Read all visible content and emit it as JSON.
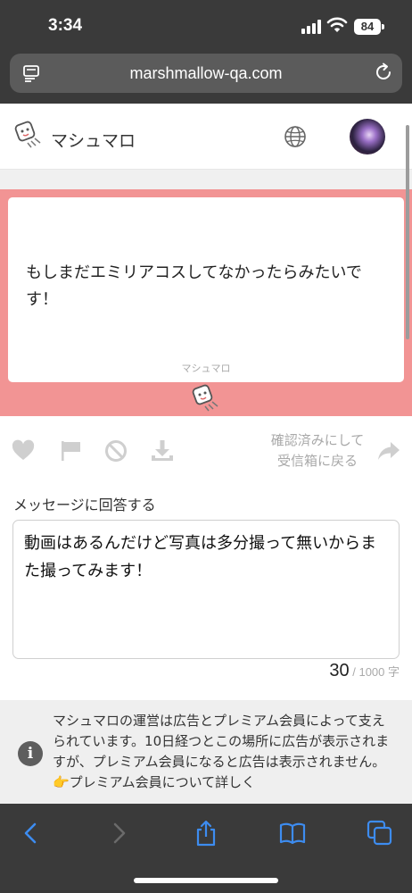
{
  "status": {
    "time": "3:34",
    "battery": "84"
  },
  "browser": {
    "url": "marshmallow-qa.com"
  },
  "header": {
    "brand": "マシュマロ"
  },
  "message": {
    "text": "もしまだエミリアコスしてなかったらみたいです！",
    "card_brand": "マシュマロ"
  },
  "actions": {
    "mark_read_line1": "確認済みにして",
    "mark_read_line2": "受信箱に戻る"
  },
  "reply": {
    "label": "メッセージに回答する",
    "value": "動画はあるんだけど写真は多分撮って無いからまた撮ってみます！",
    "count": "30",
    "max": "/ 1000 字"
  },
  "notice": {
    "text": "マシュマロの運営は広告とプレミアム会員によって支えられています。10日経つとこの場所に広告が表示されますが、プレミアム会員になると広告は表示されません。",
    "link": "👉プレミアム会員について詳しく"
  },
  "colors": {
    "accent": "#f29494",
    "chrome": "#3a3a3a",
    "toolbar_icon": "#3d8cf0",
    "muted_icon": "#cfcfcf"
  }
}
